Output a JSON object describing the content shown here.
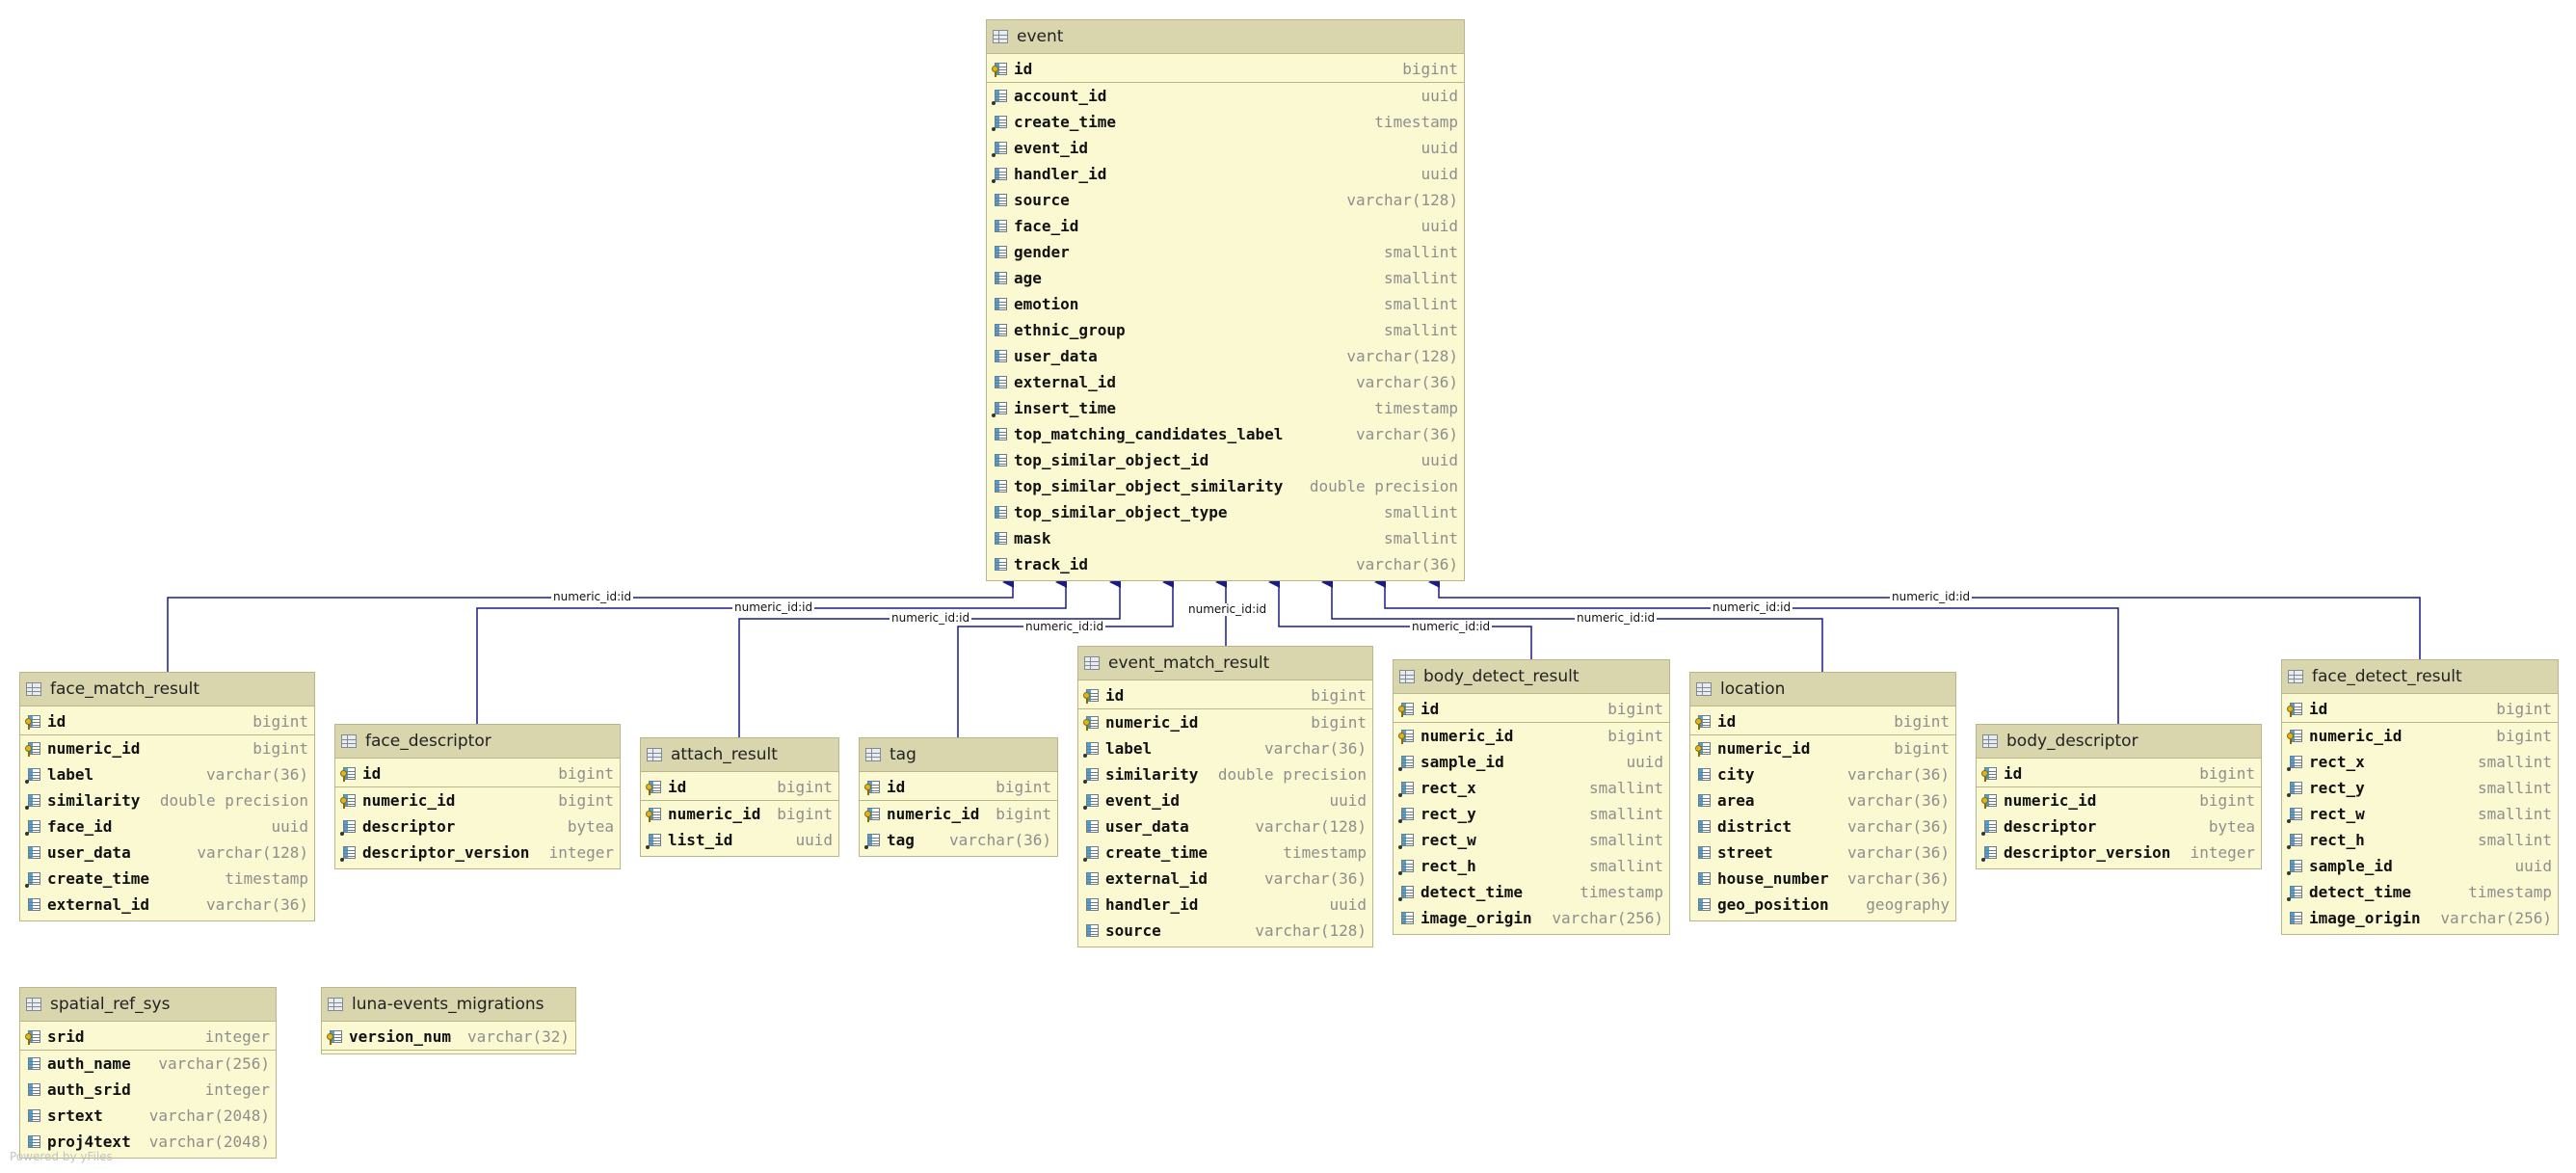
{
  "tables": [
    {
      "key": "event",
      "name": "event",
      "columns": [
        {
          "n": "id",
          "t": "bigint",
          "pk": true
        },
        {
          "n": "account_id",
          "t": "uuid",
          "nn": true
        },
        {
          "n": "create_time",
          "t": "timestamp",
          "nn": true
        },
        {
          "n": "event_id",
          "t": "uuid",
          "nn": true
        },
        {
          "n": "handler_id",
          "t": "uuid",
          "nn": true
        },
        {
          "n": "source",
          "t": "varchar(128)"
        },
        {
          "n": "face_id",
          "t": "uuid"
        },
        {
          "n": "gender",
          "t": "smallint"
        },
        {
          "n": "age",
          "t": "smallint"
        },
        {
          "n": "emotion",
          "t": "smallint"
        },
        {
          "n": "ethnic_group",
          "t": "smallint"
        },
        {
          "n": "user_data",
          "t": "varchar(128)"
        },
        {
          "n": "external_id",
          "t": "varchar(36)"
        },
        {
          "n": "insert_time",
          "t": "timestamp",
          "nn": true
        },
        {
          "n": "top_matching_candidates_label",
          "t": "varchar(36)"
        },
        {
          "n": "top_similar_object_id",
          "t": "uuid"
        },
        {
          "n": "top_similar_object_similarity",
          "t": "double precision"
        },
        {
          "n": "top_similar_object_type",
          "t": "smallint"
        },
        {
          "n": "mask",
          "t": "smallint"
        },
        {
          "n": "track_id",
          "t": "varchar(36)"
        }
      ]
    },
    {
      "key": "face_match_result",
      "name": "face_match_result",
      "columns": [
        {
          "n": "id",
          "t": "bigint",
          "pk": true
        },
        {
          "n": "numeric_id",
          "t": "bigint",
          "fk": true
        },
        {
          "n": "label",
          "t": "varchar(36)",
          "nn": true
        },
        {
          "n": "similarity",
          "t": "double precision",
          "nn": true
        },
        {
          "n": "face_id",
          "t": "uuid",
          "nn": true
        },
        {
          "n": "user_data",
          "t": "varchar(128)"
        },
        {
          "n": "create_time",
          "t": "timestamp",
          "nn": true
        },
        {
          "n": "external_id",
          "t": "varchar(36)"
        }
      ]
    },
    {
      "key": "face_descriptor",
      "name": "face_descriptor",
      "columns": [
        {
          "n": "id",
          "t": "bigint",
          "pk": true
        },
        {
          "n": "numeric_id",
          "t": "bigint",
          "fk": true
        },
        {
          "n": "descriptor",
          "t": "bytea",
          "nn": true
        },
        {
          "n": "descriptor_version",
          "t": "integer",
          "nn": true
        }
      ]
    },
    {
      "key": "attach_result",
      "name": "attach_result",
      "columns": [
        {
          "n": "id",
          "t": "bigint",
          "pk": true
        },
        {
          "n": "numeric_id",
          "t": "bigint",
          "fk": true
        },
        {
          "n": "list_id",
          "t": "uuid",
          "nn": true
        }
      ]
    },
    {
      "key": "tag",
      "name": "tag",
      "columns": [
        {
          "n": "id",
          "t": "bigint",
          "pk": true
        },
        {
          "n": "numeric_id",
          "t": "bigint",
          "fk": true
        },
        {
          "n": "tag",
          "t": "varchar(36)",
          "nn": true
        }
      ]
    },
    {
      "key": "event_match_result",
      "name": "event_match_result",
      "columns": [
        {
          "n": "id",
          "t": "bigint",
          "pk": true
        },
        {
          "n": "numeric_id",
          "t": "bigint",
          "fk": true
        },
        {
          "n": "label",
          "t": "varchar(36)",
          "nn": true
        },
        {
          "n": "similarity",
          "t": "double precision",
          "nn": true
        },
        {
          "n": "event_id",
          "t": "uuid",
          "nn": true
        },
        {
          "n": "user_data",
          "t": "varchar(128)"
        },
        {
          "n": "create_time",
          "t": "timestamp",
          "nn": true
        },
        {
          "n": "external_id",
          "t": "varchar(36)"
        },
        {
          "n": "handler_id",
          "t": "uuid"
        },
        {
          "n": "source",
          "t": "varchar(128)"
        }
      ]
    },
    {
      "key": "body_detect_result",
      "name": "body_detect_result",
      "columns": [
        {
          "n": "id",
          "t": "bigint",
          "pk": true
        },
        {
          "n": "numeric_id",
          "t": "bigint",
          "fk": true
        },
        {
          "n": "sample_id",
          "t": "uuid",
          "nn": true
        },
        {
          "n": "rect_x",
          "t": "smallint",
          "nn": true
        },
        {
          "n": "rect_y",
          "t": "smallint",
          "nn": true
        },
        {
          "n": "rect_w",
          "t": "smallint",
          "nn": true
        },
        {
          "n": "rect_h",
          "t": "smallint",
          "nn": true
        },
        {
          "n": "detect_time",
          "t": "timestamp",
          "nn": true
        },
        {
          "n": "image_origin",
          "t": "varchar(256)"
        }
      ]
    },
    {
      "key": "location",
      "name": "location",
      "columns": [
        {
          "n": "id",
          "t": "bigint",
          "pk": true
        },
        {
          "n": "numeric_id",
          "t": "bigint",
          "fk": true
        },
        {
          "n": "city",
          "t": "varchar(36)"
        },
        {
          "n": "area",
          "t": "varchar(36)"
        },
        {
          "n": "district",
          "t": "varchar(36)"
        },
        {
          "n": "street",
          "t": "varchar(36)"
        },
        {
          "n": "house_number",
          "t": "varchar(36)"
        },
        {
          "n": "geo_position",
          "t": "geography"
        }
      ]
    },
    {
      "key": "body_descriptor",
      "name": "body_descriptor",
      "columns": [
        {
          "n": "id",
          "t": "bigint",
          "pk": true
        },
        {
          "n": "numeric_id",
          "t": "bigint",
          "fk": true
        },
        {
          "n": "descriptor",
          "t": "bytea",
          "nn": true
        },
        {
          "n": "descriptor_version",
          "t": "integer",
          "nn": true
        }
      ]
    },
    {
      "key": "face_detect_result",
      "name": "face_detect_result",
      "columns": [
        {
          "n": "id",
          "t": "bigint",
          "pk": true
        },
        {
          "n": "numeric_id",
          "t": "bigint",
          "fk": true
        },
        {
          "n": "rect_x",
          "t": "smallint",
          "nn": true
        },
        {
          "n": "rect_y",
          "t": "smallint",
          "nn": true
        },
        {
          "n": "rect_w",
          "t": "smallint",
          "nn": true
        },
        {
          "n": "rect_h",
          "t": "smallint",
          "nn": true
        },
        {
          "n": "sample_id",
          "t": "uuid",
          "nn": true
        },
        {
          "n": "detect_time",
          "t": "timestamp",
          "nn": true
        },
        {
          "n": "image_origin",
          "t": "varchar(256)"
        }
      ]
    },
    {
      "key": "spatial_ref_sys",
      "name": "spatial_ref_sys",
      "columns": [
        {
          "n": "srid",
          "t": "integer",
          "pk": true
        },
        {
          "n": "auth_name",
          "t": "varchar(256)"
        },
        {
          "n": "auth_srid",
          "t": "integer"
        },
        {
          "n": "srtext",
          "t": "varchar(2048)"
        },
        {
          "n": "proj4text",
          "t": "varchar(2048)"
        }
      ]
    },
    {
      "key": "luna_events_migrations",
      "name": "luna-events_migrations",
      "columns": [
        {
          "n": "version_num",
          "t": "varchar(32)",
          "pk": true
        }
      ]
    }
  ],
  "relationships": [
    {
      "from": "face_match_result",
      "label": "numeric_id:id"
    },
    {
      "from": "face_descriptor",
      "label": "numeric_id:id"
    },
    {
      "from": "attach_result",
      "label": "numeric_id:id"
    },
    {
      "from": "tag",
      "label": "numeric_id:id"
    },
    {
      "from": "event_match_result",
      "label": "numeric_id:id"
    },
    {
      "from": "body_detect_result",
      "label": "numeric_id:id"
    },
    {
      "from": "location",
      "label": "numeric_id:id"
    },
    {
      "from": "body_descriptor",
      "label": "numeric_id:id"
    },
    {
      "from": "face_detect_result",
      "label": "numeric_id:id"
    }
  ],
  "watermark": "Powered by yFiles"
}
